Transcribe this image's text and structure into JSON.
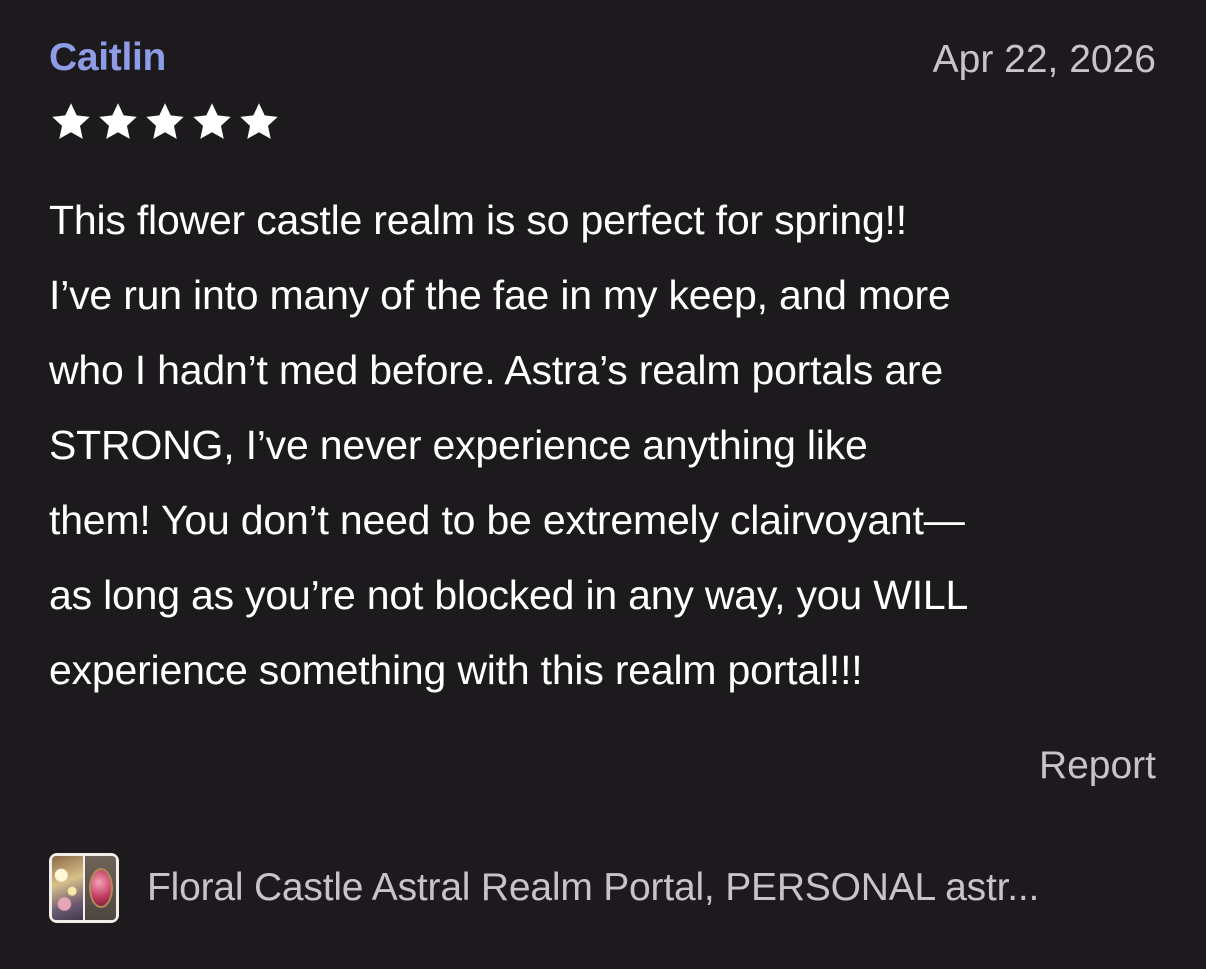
{
  "review": {
    "reviewer_name": "Caitlin",
    "date": "Apr 22, 2026",
    "rating": 5,
    "rating_max": 5,
    "text_lines": [
      "This flower castle realm is so perfect for spring!!",
      "I’ve run into many of the fae in my keep, and more",
      "who I hadn’t med before. Astra’s realm portals are",
      "STRONG, I’ve never experience anything like",
      "them! You don’t need to be extremely clairvoyant—",
      "as long as you’re not blocked in any way, you WILL",
      "experience something with this realm portal!!!"
    ],
    "report_label": "Report"
  },
  "listing": {
    "title": "Floral Castle Astral Realm Portal, PERSONAL astr..."
  },
  "colors": {
    "background": "#1d1a1e",
    "reviewer_name": "#8e9be6",
    "secondary_text": "#c7c3cb",
    "primary_text": "#ffffff",
    "star": "#ffffff"
  },
  "icons": {
    "star": "star-icon"
  }
}
